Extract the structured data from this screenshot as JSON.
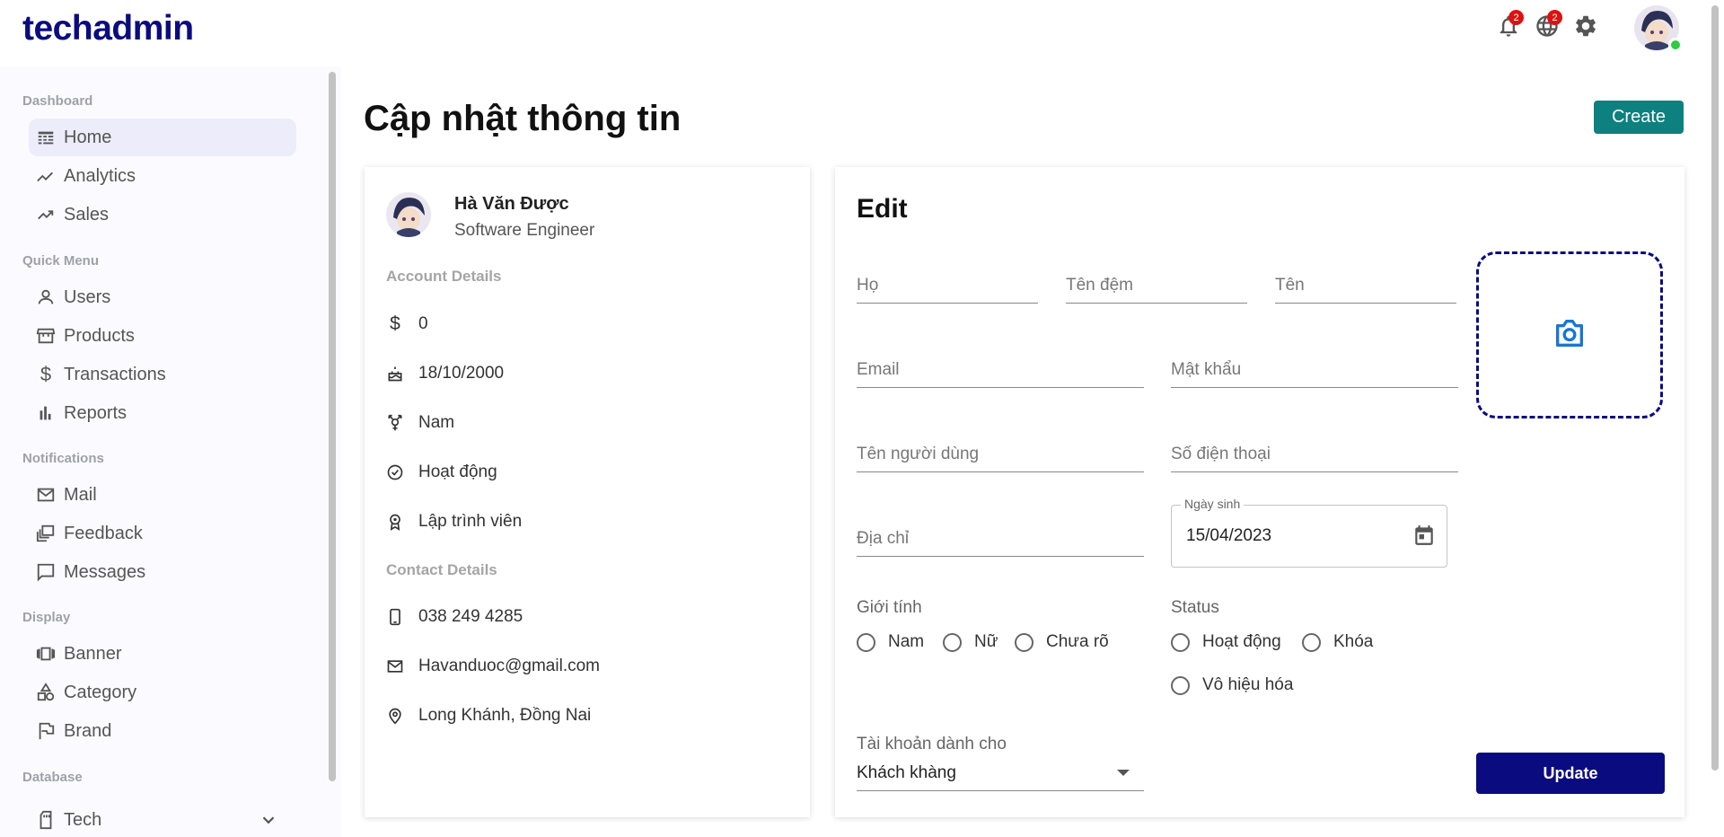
{
  "app": {
    "logo": "techadmin"
  },
  "topbar": {
    "notifications_count": "2",
    "language_count": "2"
  },
  "sidebar": {
    "sections": [
      {
        "title": "Dashboard",
        "items": [
          {
            "label": "Home",
            "icon": "home-icon",
            "active": true
          },
          {
            "label": "Analytics",
            "icon": "timeline-icon"
          },
          {
            "label": "Sales",
            "icon": "trending-up-icon"
          }
        ]
      },
      {
        "title": "Quick Menu",
        "items": [
          {
            "label": "Users",
            "icon": "user-icon"
          },
          {
            "label": "Products",
            "icon": "store-icon"
          },
          {
            "label": "Transactions",
            "icon": "dollar-icon"
          },
          {
            "label": "Reports",
            "icon": "bar-chart-icon"
          }
        ]
      },
      {
        "title": "Notifications",
        "items": [
          {
            "label": "Mail",
            "icon": "mail-icon"
          },
          {
            "label": "Feedback",
            "icon": "feedback-icon"
          },
          {
            "label": "Messages",
            "icon": "message-icon"
          }
        ]
      },
      {
        "title": "Display",
        "items": [
          {
            "label": "Banner",
            "icon": "banner-icon"
          },
          {
            "label": "Category",
            "icon": "category-icon"
          },
          {
            "label": "Brand",
            "icon": "flag-icon"
          }
        ]
      },
      {
        "title": "Database",
        "items": [
          {
            "label": "Tech",
            "icon": "sd-card-icon"
          }
        ]
      }
    ]
  },
  "main": {
    "title": "Cập nhật thông tin",
    "create_label": "Create"
  },
  "profile": {
    "name": "Hà Văn Được",
    "job": "Software Engineer",
    "account_title": "Account Details",
    "balance": "0",
    "birthday": "18/10/2000",
    "gender": "Nam",
    "status": "Hoạt động",
    "role": "Lập trình viên",
    "contact_title": "Contact Details",
    "phone": "038 249 4285",
    "email": "Havanduoc@gmail.com",
    "address": "Long Khánh, Đồng Nai"
  },
  "edit": {
    "title": "Edit",
    "placeholders": {
      "ho": "Họ",
      "ten_dem": "Tên đệm",
      "ten": "Tên",
      "email": "Email",
      "mat_khau": "Mật khẩu",
      "ten_nguoi_dung": "Tên người dùng",
      "so_dien_thoai": "Số điện thoại",
      "dia_chi": "Địa chỉ"
    },
    "date_label": "Ngày sinh",
    "date_value": "15/04/2023",
    "gender_label": "Giới tính",
    "gender_options": [
      "Nam",
      "Nữ",
      "Chưa rõ"
    ],
    "status_label": "Status",
    "status_options": [
      "Hoạt động",
      "Khóa",
      "Vô hiệu hóa"
    ],
    "account_for_label": "Tài khoản dành cho",
    "account_for_value": "Khách khàng",
    "update_label": "Update"
  },
  "colors": {
    "brand": "#0b0b80",
    "create": "#0d8080",
    "badge": "#e01010"
  }
}
